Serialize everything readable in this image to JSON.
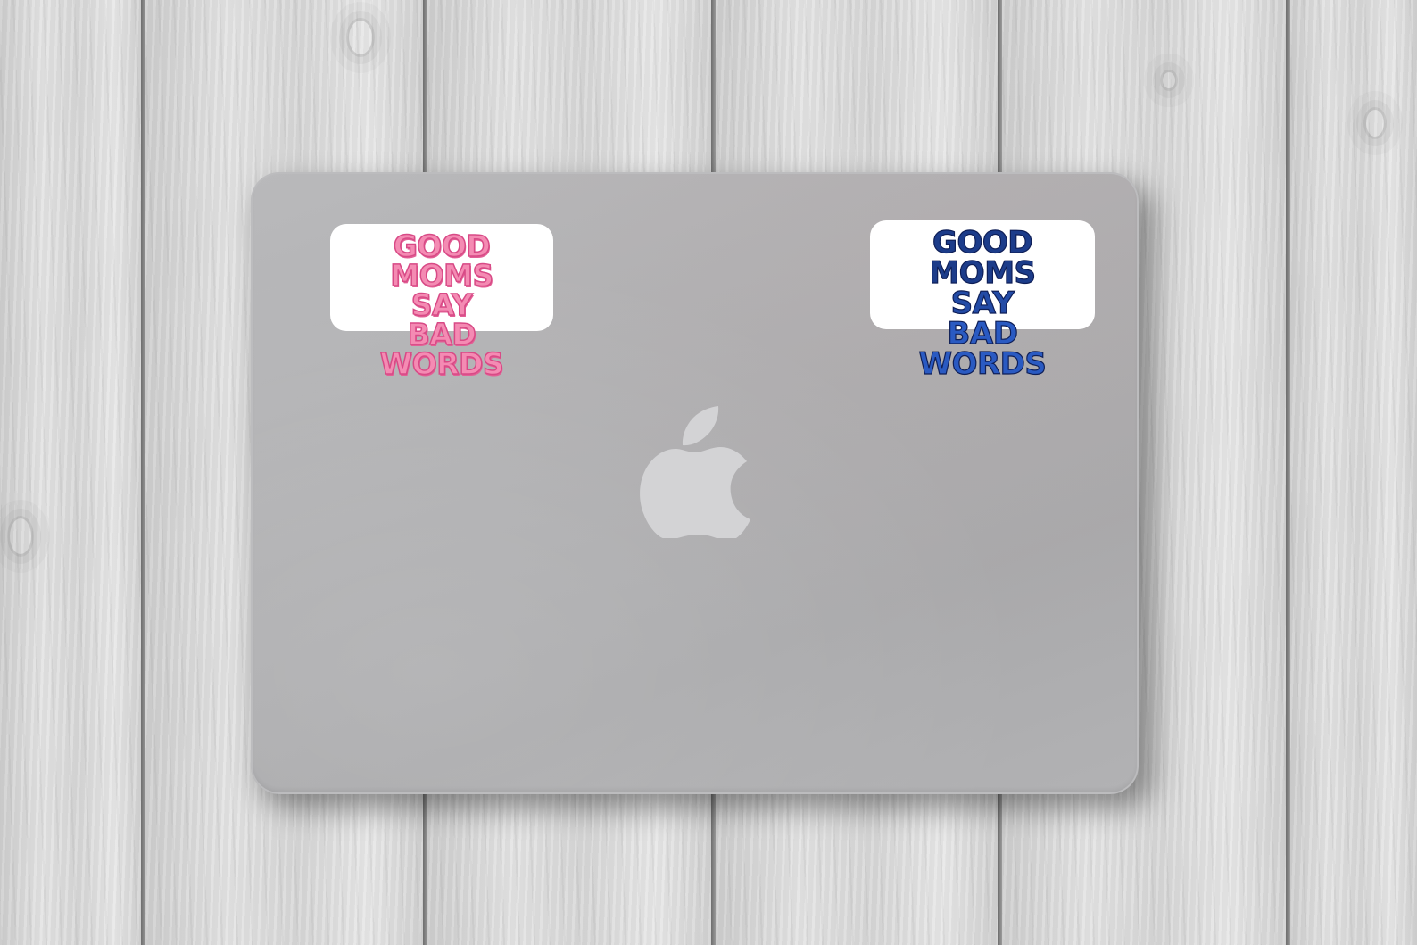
{
  "stickers": {
    "pink": {
      "line1": "GOOD MOMS",
      "line2": "SAY",
      "line3": "BAD WORDS",
      "color": "#f48bb3"
    },
    "blue": {
      "line1": "GOOD MOMS",
      "line2": "SAY",
      "line3": "BAD WORDS",
      "color": "#1c3c8a"
    }
  },
  "laptop": {
    "logo": "apple-logo",
    "color": "#aeaeb0"
  },
  "background": {
    "texture": "white-painted-wood-planks",
    "color": "#d9d9d9"
  }
}
